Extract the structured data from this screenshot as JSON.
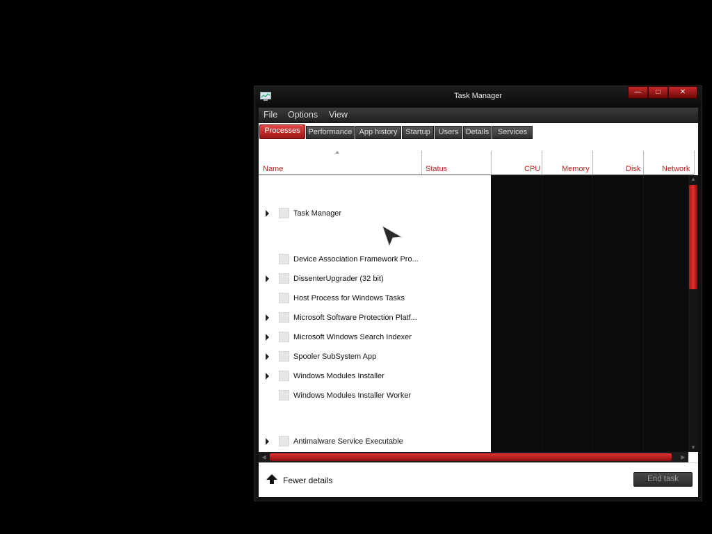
{
  "window": {
    "title": "Task Manager",
    "controls": {
      "minimize": "—",
      "maximize": "□",
      "close": "✕"
    }
  },
  "menu": [
    "File",
    "Options",
    "View"
  ],
  "tabs": [
    "Processes",
    "Performance",
    "App history",
    "Startup",
    "Users",
    "Details",
    "Services"
  ],
  "active_tab": "Processes",
  "columns": {
    "name": "Name",
    "status": "Status",
    "cpu": "CPU",
    "memory": "Memory",
    "disk": "Disk",
    "network": "Network"
  },
  "processes": [
    {
      "name": "Task Manager",
      "expandable": true
    },
    {
      "name": "Device Association Framework Pro...",
      "expandable": false
    },
    {
      "name": "DissenterUpgrader (32 bit)",
      "expandable": true
    },
    {
      "name": "Host Process for Windows Tasks",
      "expandable": false
    },
    {
      "name": "Microsoft Software Protection Platf...",
      "expandable": true
    },
    {
      "name": "Microsoft Windows Search Indexer",
      "expandable": true
    },
    {
      "name": "Spooler SubSystem App",
      "expandable": true
    },
    {
      "name": "Windows Modules Installer",
      "expandable": true
    },
    {
      "name": "Windows Modules Installer Worker",
      "expandable": false
    },
    {
      "name": "Antimalware Service Executable",
      "expandable": true
    }
  ],
  "footer": {
    "fewer_details": "Fewer details",
    "end_task": "End task"
  },
  "colors": {
    "accent": "#c41e1e",
    "tab_active": "#d43434",
    "background": "#000000"
  },
  "icons": {
    "app": "task-manager-icon",
    "fewer": "arrow-up-icon",
    "cursor": "mouse-pointer-icon"
  }
}
